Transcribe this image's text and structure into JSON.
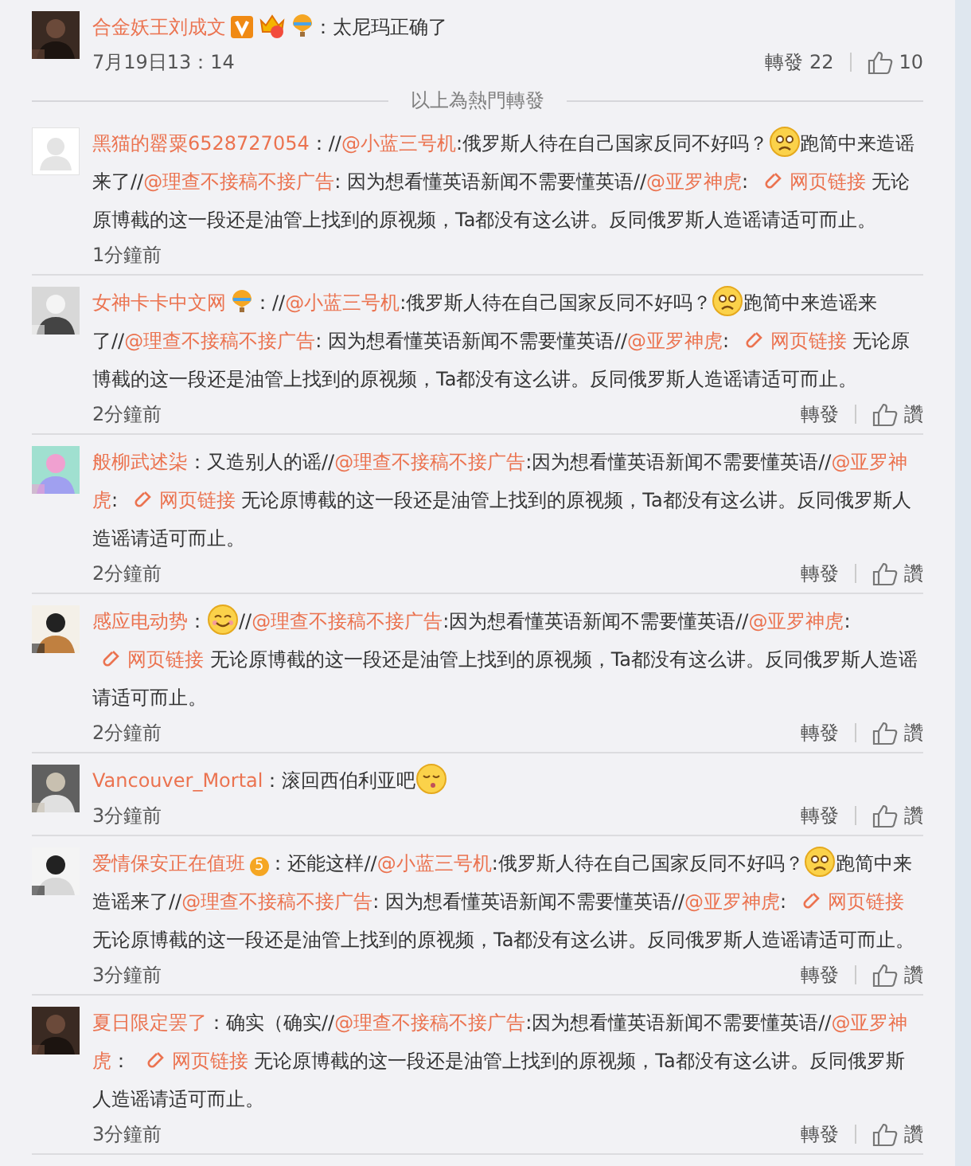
{
  "hot_comments": [
    {
      "name": "合金妖王刘成文",
      "avatar": {
        "kind": "picture"
      },
      "badges": [
        {
          "kind": "vip"
        },
        {
          "kind": "crown"
        },
        {
          "kind": "balloon"
        }
      ],
      "segments": [
        {
          "kind": "text",
          "text": "：太尼玛正确了"
        }
      ],
      "time": "7月19日13：14",
      "repost": "轉發 22",
      "like": "10"
    }
  ],
  "divider": "以上為熱門轉發",
  "comments": [
    {
      "name": "黑猫的罂粟6528727054",
      "avatar": {
        "kind": "default"
      },
      "segments": [
        {
          "kind": "text",
          "text": "：//"
        },
        {
          "kind": "mention",
          "text": "@小蓝三号机"
        },
        {
          "kind": "text",
          "text": ":俄罗斯人待在自己国家反同不好吗？"
        },
        {
          "kind": "sad"
        },
        {
          "kind": "text",
          "text": "跑简中来造谣来了//"
        },
        {
          "kind": "mention",
          "text": "@理查不接稿不接广告"
        },
        {
          "kind": "text",
          "text": ": 因为想看懂英语新闻不需要懂英语//"
        },
        {
          "kind": "mention",
          "text": "@亚罗神虎"
        },
        {
          "kind": "text",
          "text": ": "
        },
        {
          "kind": "link",
          "text": "网页链接"
        },
        {
          "kind": "text",
          "text": " 无论原博截的这一段还是油管上找到的原视频，Ta都没有这么讲。反同俄罗斯人造谣请适可而止。"
        }
      ],
      "time": "1分鐘前"
    },
    {
      "name": "女神卡卡中文网",
      "avatar": {
        "kind": "picture"
      },
      "badges": [
        {
          "kind": "balloon"
        }
      ],
      "segments": [
        {
          "kind": "text",
          "text": "：//"
        },
        {
          "kind": "mention",
          "text": "@小蓝三号机"
        },
        {
          "kind": "text",
          "text": ":俄罗斯人待在自己国家反同不好吗？"
        },
        {
          "kind": "sad"
        },
        {
          "kind": "text",
          "text": "跑简中来造谣来了//"
        },
        {
          "kind": "mention",
          "text": "@理查不接稿不接广告"
        },
        {
          "kind": "text",
          "text": ": 因为想看懂英语新闻不需要懂英语//"
        },
        {
          "kind": "mention",
          "text": "@亚罗神虎"
        },
        {
          "kind": "text",
          "text": ": "
        },
        {
          "kind": "link",
          "text": "网页链接"
        },
        {
          "kind": "text",
          "text": " 无论原博截的这一段还是油管上找到的原视频，Ta都没有这么讲。反同俄罗斯人造谣请适可而止。"
        }
      ],
      "time": "2分鐘前",
      "repost": "轉發",
      "like": "讚"
    },
    {
      "name": "般柳武述柒",
      "avatar": {
        "kind": "picture"
      },
      "segments": [
        {
          "kind": "text",
          "text": "：又造别人的谣//"
        },
        {
          "kind": "mention",
          "text": "@理查不接稿不接广告"
        },
        {
          "kind": "text",
          "text": ":因为想看懂英语新闻不需要懂英语//"
        },
        {
          "kind": "mention",
          "text": "@亚罗神虎"
        },
        {
          "kind": "text",
          "text": ": "
        },
        {
          "kind": "link",
          "text": "网页链接"
        },
        {
          "kind": "text",
          "text": " 无论原博截的这一段还是油管上找到的原视频，Ta都没有这么讲。反同俄罗斯人造谣请适可而止。"
        }
      ],
      "time": "2分鐘前",
      "repost": "轉發",
      "like": "讚"
    },
    {
      "name": "感应电动势",
      "avatar": {
        "kind": "picture"
      },
      "segments": [
        {
          "kind": "text",
          "text": "："
        },
        {
          "kind": "smile"
        },
        {
          "kind": "text",
          "text": "//"
        },
        {
          "kind": "mention",
          "text": "@理查不接稿不接广告"
        },
        {
          "kind": "text",
          "text": ":因为想看懂英语新闻不需要懂英语//"
        },
        {
          "kind": "mention",
          "text": "@亚罗神虎"
        },
        {
          "kind": "text",
          "text": ": "
        },
        {
          "kind": "link",
          "text": "网页链接"
        },
        {
          "kind": "text",
          "text": " 无论原博截的这一段还是油管上找到的原视频，Ta都没有这么讲。反同俄罗斯人造谣请适可而止。"
        }
      ],
      "time": "2分鐘前",
      "repost": "轉發",
      "like": "讚"
    },
    {
      "name": "Vancouver_Mortal",
      "avatar": {
        "kind": "picture"
      },
      "segments": [
        {
          "kind": "text",
          "text": "：滚回西伯利亚吧"
        },
        {
          "kind": "kiss"
        }
      ],
      "time": "3分鐘前",
      "repost": "轉發",
      "like": "讚"
    },
    {
      "name": "爱情保安正在值班",
      "avatar": {
        "kind": "picture"
      },
      "badges": [
        {
          "kind": "fan",
          "label": "5"
        }
      ],
      "segments": [
        {
          "kind": "text",
          "text": "：还能这样//"
        },
        {
          "kind": "mention",
          "text": "@小蓝三号机"
        },
        {
          "kind": "text",
          "text": ":俄罗斯人待在自己国家反同不好吗？"
        },
        {
          "kind": "sad"
        },
        {
          "kind": "text",
          "text": "跑简中来造谣来了//"
        },
        {
          "kind": "mention",
          "text": "@理查不接稿不接广告"
        },
        {
          "kind": "text",
          "text": ": 因为想看懂英语新闻不需要懂英语//"
        },
        {
          "kind": "mention",
          "text": "@亚罗神虎"
        },
        {
          "kind": "text",
          "text": ": "
        },
        {
          "kind": "link",
          "text": "网页链接"
        },
        {
          "kind": "text",
          "text": " 无论原博截的这一段还是油管上找到的原视频，Ta都没有这么讲。反同俄罗斯人造谣请适可而止。"
        }
      ],
      "time": "3分鐘前",
      "repost": "轉發",
      "like": "讚"
    },
    {
      "name": "夏日限定罢了",
      "avatar": {
        "kind": "picture"
      },
      "segments": [
        {
          "kind": "text",
          "text": "：确实（确实//"
        },
        {
          "kind": "mention",
          "text": "@理查不接稿不接广告"
        },
        {
          "kind": "text",
          "text": ":因为想看懂英语新闻不需要懂英语//"
        },
        {
          "kind": "mention",
          "text": "@亚罗神虎"
        },
        {
          "kind": "text",
          "text": "： "
        },
        {
          "kind": "link",
          "text": "网页链接"
        },
        {
          "kind": "text",
          "text": " 无论原博截的这一段还是油管上找到的原视频，Ta都没有这么讲。反同俄罗斯人造谣请适可而止。"
        }
      ],
      "time": "3分鐘前",
      "repost": "轉發",
      "like": "讚"
    }
  ]
}
